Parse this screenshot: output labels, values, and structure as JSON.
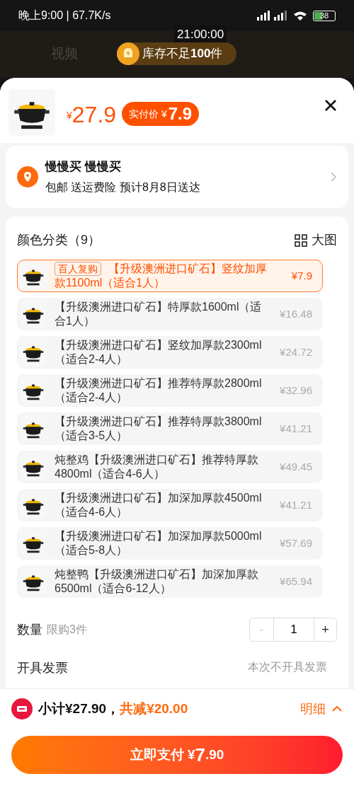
{
  "status_bar": {
    "time": "晚上9:00 | 67.7K/s",
    "battery": "38"
  },
  "background": {
    "nav_tab": "视频",
    "countdown": "21:00:00",
    "stock_notice": "库存不足**100**件"
  },
  "product": {
    "currency": "¥",
    "price": "27.9",
    "paid_label": "实付价 ¥",
    "paid_price": "7.9"
  },
  "address": {
    "name": "慢慢买 慢慢买",
    "delivery": "包邮 送运费险 预计8月8日送达"
  },
  "specs": {
    "title": "颜色分类（9）",
    "view_toggle": "大图",
    "options": [
      {
        "name": "【升级澳洲进口矿石】竖纹加厚款1100ml（适合1人）",
        "badge": "百人复购",
        "price": "¥7.9",
        "selected": true
      },
      {
        "name": "【升级澳洲进口矿石】特厚款1600ml（适合1人）",
        "price": "¥16.48",
        "selected": false
      },
      {
        "name": "【升级澳洲进口矿石】竖纹加厚款2300ml（适合2-4人）",
        "price": "¥24.72",
        "selected": false
      },
      {
        "name": "【升级澳洲进口矿石】推荐特厚款2800ml（适合2-4人）",
        "price": "¥32.96",
        "selected": false
      },
      {
        "name": "【升级澳洲进口矿石】推荐特厚款3800ml（适合3-5人）",
        "price": "¥41.21",
        "selected": false
      },
      {
        "name": "炖整鸡【升级澳洲进口矿石】推荐特厚款4800ml（适合4-6人）",
        "price": "¥49.45",
        "selected": false
      },
      {
        "name": "【升级澳洲进口矿石】加深加厚款4500ml（适合4-6人）",
        "price": "¥41.21",
        "selected": false
      },
      {
        "name": "【升级澳洲进口矿石】加深加厚款5000ml（适合5-8人）",
        "price": "¥57.69",
        "selected": false
      },
      {
        "name": "炖整鸭【升级澳洲进口矿石】加深加厚款6500ml（适合6-12人）",
        "price": "¥65.94",
        "selected": false
      }
    ],
    "quantity_label": "数量",
    "quantity_limit": "限购3件",
    "minus": "-",
    "quantity": "1",
    "plus": "+",
    "minus_disabled": true
  },
  "invoice": {
    "label": "开具发票",
    "value": "本次不开具发票"
  },
  "footer": {
    "subtotal": "小计¥27.90，",
    "discount": "共减¥20.00",
    "details": "明细",
    "pay_label": "立即支付 ¥",
    "pay_amount": "7",
    "pay_cents": ".90"
  }
}
